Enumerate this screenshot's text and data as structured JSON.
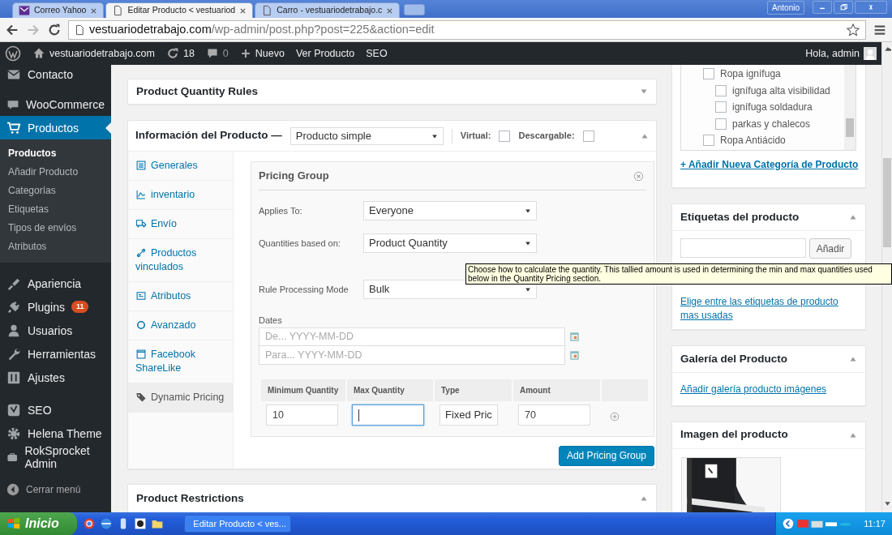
{
  "browser": {
    "tabs": [
      {
        "title": "Correo Yahoo",
        "kind": "mail",
        "selected": false
      },
      {
        "title": "Editar Producto < vestuariod",
        "kind": "page",
        "selected": true
      },
      {
        "title": "Carro - vestuariodetrabajo.c",
        "kind": "page",
        "selected": false
      }
    ],
    "profile": "Antonio",
    "url_host": "vestuariodetrabajo.com",
    "url_path": "/wp-admin/post.php?post=225&action=edit"
  },
  "admin_bar": {
    "site": "vestuariodetrabajo.com",
    "updates": "18",
    "comments": "0",
    "new": "Nuevo",
    "links": [
      "Ver Producto",
      "SEO"
    ],
    "greeting": "Hola, admin"
  },
  "sidebar": {
    "groups": [
      {
        "items": [
          {
            "label": "Contacto",
            "kind": "mail",
            "selected": false
          }
        ]
      },
      {
        "items": [
          {
            "label": "WooCommerce",
            "kind": "woo",
            "selected": false
          },
          {
            "label": "Productos",
            "kind": "cart",
            "selected": true,
            "submenu": [
              {
                "label": "Productos",
                "selected": true
              },
              {
                "label": "Añadir Producto",
                "selected": false
              },
              {
                "label": "Categorías",
                "selected": false
              },
              {
                "label": "Etiquetas",
                "selected": false
              },
              {
                "label": "Tipos de envíos",
                "selected": false
              },
              {
                "label": "Atributos",
                "selected": false
              }
            ]
          }
        ]
      },
      {
        "items": [
          {
            "label": "Apariencia",
            "kind": "brush",
            "selected": false
          },
          {
            "label": "Plugins",
            "kind": "plug",
            "selected": false,
            "badge": "11"
          },
          {
            "label": "Usuarios",
            "kind": "user",
            "selected": false
          },
          {
            "label": "Herramientas",
            "kind": "wrench",
            "selected": false
          },
          {
            "label": "Ajustes",
            "kind": "sliders",
            "selected": false
          }
        ]
      },
      {
        "items": [
          {
            "label": "SEO",
            "kind": "seo",
            "selected": false
          },
          {
            "label": "Helena Theme",
            "kind": "gear",
            "selected": false
          },
          {
            "label": "RokSprocket Admin",
            "kind": "box",
            "selected": false
          }
        ]
      }
    ],
    "collapse": "Cerrar menú"
  },
  "quantity_rules": {
    "title": "Product Quantity Rules",
    "expanded": false
  },
  "product_data": {
    "title": "Información del Producto —",
    "expanded": true,
    "type": "Producto simple",
    "virtual": {
      "label": "Virtual:",
      "checked": false
    },
    "downloadable": {
      "label": "Descargable:",
      "checked": false
    },
    "tabs": [
      {
        "label": "Generales",
        "kind": "general",
        "selected": false
      },
      {
        "label": "inventario",
        "kind": "inventory",
        "selected": false
      },
      {
        "label": "Envío",
        "kind": "shipping",
        "selected": false
      },
      {
        "label": "Productos vinculados",
        "kind": "linked",
        "selected": false
      },
      {
        "label": "Atributos",
        "kind": "attributes",
        "selected": false
      },
      {
        "label": "Avanzado",
        "kind": "advanced",
        "selected": false
      },
      {
        "label": "Facebook ShareLike",
        "kind": "facebook",
        "selected": false
      },
      {
        "label": "Dynamic Pricing",
        "kind": "pricing",
        "selected": true
      }
    ],
    "pricing_group": {
      "title": "Pricing Group",
      "fields": [
        {
          "label": "Applies To:",
          "value": "Everyone"
        },
        {
          "label": "Quantities based on:",
          "value": "Product Quantity"
        },
        {
          "label": "Rule Processing Mode",
          "value": "Bulk"
        }
      ],
      "dates_label": "Dates",
      "date_placeholders": [
        "De... YYYY-MM-DD",
        "Para... YYYY-MM-DD"
      ],
      "columns": [
        "Minimum Quantity",
        "Max Quantity",
        "Type",
        "Amount"
      ],
      "rows": [
        {
          "min": "10",
          "max_focused": true,
          "type": "Fixed Pric",
          "amount": "70"
        }
      ]
    },
    "add_button": "Add Pricing Group"
  },
  "restrictions": {
    "title": "Product Restrictions",
    "expanded": true
  },
  "categories": {
    "items": [
      {
        "label": "Ropa ignífuga",
        "checked": false,
        "children": [
          {
            "label": "ignífuga alta visibilidad",
            "checked": false
          },
          {
            "label": "ignífuga soldadura",
            "checked": false
          },
          {
            "label": "parkas y chalecos",
            "checked": false
          }
        ]
      },
      {
        "label": "Ropa Antiácido",
        "checked": false
      }
    ],
    "add_link": "+ Añadir Nueva Categoría de Producto"
  },
  "tags": {
    "title": "Etiquetas del producto",
    "expanded": true,
    "button": "Añadir",
    "link": "Elige entre las etiquetas de producto mas usadas"
  },
  "gallery": {
    "title": "Galería del Producto",
    "expanded": true,
    "link": "Añadir galería producto imágenes"
  },
  "image": {
    "title": "Imagen del producto",
    "expanded": true,
    "kind": "picture"
  },
  "tooltip": "Choose how to calculate the quantity.  This tallied amount is used in determining the min and max quantities used below in the Quantity Pricing section.",
  "taskbar": {
    "start": "Inicio",
    "tasks": [
      {
        "title": "Editar Producto < ves..."
      }
    ],
    "clock": "11:17"
  }
}
